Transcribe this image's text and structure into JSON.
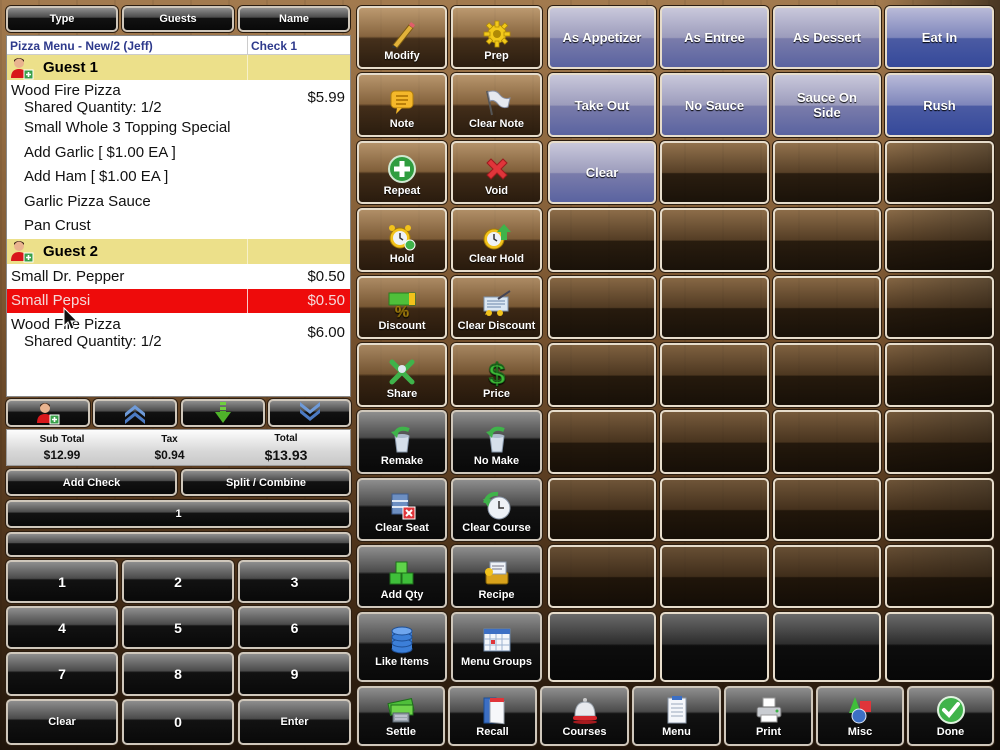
{
  "header_tabs": [
    "Type",
    "Guests",
    "Name"
  ],
  "order": {
    "title": "Pizza Menu - New/2 (Jeff)",
    "check": "Check 1",
    "guests": [
      {
        "name": "Guest 1",
        "items": [
          {
            "name": "Wood Fire Pizza",
            "sub": "Shared Quantity: 1/2",
            "price": "$5.99",
            "modifiers": [
              "Small Whole 3 Topping Special",
              "Add Garlic [ $1.00 EA ]",
              "Add Ham [ $1.00 EA ]",
              "Garlic Pizza Sauce",
              "Pan Crust"
            ]
          }
        ]
      },
      {
        "name": "Guest 2",
        "items": [
          {
            "name": "Small Dr. Pepper",
            "price": "$0.50"
          },
          {
            "name": "Small Pepsi",
            "price": "$0.50",
            "selected": true
          },
          {
            "name": "Wood Fire Pizza",
            "sub": "Shared Quantity: 1/2",
            "price": "$6.00"
          }
        ]
      }
    ]
  },
  "nav_icons": [
    "add-guest",
    "page-up",
    "move-down",
    "page-down"
  ],
  "totals": {
    "subtotal_label": "Sub Total",
    "subtotal": "$12.99",
    "tax_label": "Tax",
    "tax": "$0.94",
    "total_label": "Total",
    "total": "$13.93"
  },
  "check_actions": {
    "add_check": "Add Check",
    "split": "Split / Combine"
  },
  "qty_display": "1",
  "entry_display": "",
  "keypad": [
    "1",
    "2",
    "3",
    "4",
    "5",
    "6",
    "7",
    "8",
    "9",
    "Clear",
    "0",
    "Enter"
  ],
  "functions": [
    {
      "label": "Modify",
      "icon": "pencil"
    },
    {
      "label": "Prep",
      "icon": "gear"
    },
    {
      "label": "Note",
      "icon": "note"
    },
    {
      "label": "Clear Note",
      "icon": "flag"
    },
    {
      "label": "Repeat",
      "icon": "plus-circle"
    },
    {
      "label": "Void",
      "icon": "red-x"
    },
    {
      "label": "Hold",
      "icon": "alarm-clock"
    },
    {
      "label": "Clear Hold",
      "icon": "alarm-clock-up"
    },
    {
      "label": "Discount",
      "icon": "discount"
    },
    {
      "label": "Clear Discount",
      "icon": "clear-discount"
    },
    {
      "label": "Share",
      "icon": "share-arrows"
    },
    {
      "label": "Price",
      "icon": "dollar"
    },
    {
      "label": "Remake",
      "icon": "bucket-arrow"
    },
    {
      "label": "No Make",
      "icon": "bucket-arrow"
    },
    {
      "label": "Clear Seat",
      "icon": "seat-x"
    },
    {
      "label": "Clear Course",
      "icon": "clock-arrow"
    },
    {
      "label": "Add Qty",
      "icon": "green-blocks"
    },
    {
      "label": "Recipe",
      "icon": "recipe"
    },
    {
      "label": "Like Items",
      "icon": "database"
    },
    {
      "label": "Menu Groups",
      "icon": "calendar"
    }
  ],
  "modifiers": [
    [
      "As Appetizer",
      "As Entree",
      "As Dessert",
      "Eat In"
    ],
    [
      "Take Out",
      "No Sauce",
      "Sauce On Side",
      "Rush"
    ],
    [
      "Clear",
      "",
      "",
      ""
    ],
    [
      "",
      "",
      "",
      ""
    ],
    [
      "",
      "",
      "",
      ""
    ],
    [
      "",
      "",
      "",
      ""
    ],
    [
      "",
      "",
      "",
      ""
    ],
    [
      "",
      "",
      "",
      ""
    ],
    [
      "",
      "",
      "",
      ""
    ],
    [
      "",
      "",
      "",
      ""
    ]
  ],
  "bottom_bar": [
    {
      "label": "Settle",
      "icon": "money"
    },
    {
      "label": "Recall",
      "icon": "binder"
    },
    {
      "label": "Courses",
      "icon": "service-bell"
    },
    {
      "label": "Menu",
      "icon": "clipboard"
    },
    {
      "label": "Print",
      "icon": "printer"
    },
    {
      "label": "Misc",
      "icon": "shapes"
    },
    {
      "label": "Done",
      "icon": "check-circle"
    }
  ],
  "colors": {
    "selected_row": "#ee0b0b",
    "guest_row": "#ece08a",
    "header_text": "#2e3a8c",
    "modifier_blue": "#6f78b3"
  }
}
